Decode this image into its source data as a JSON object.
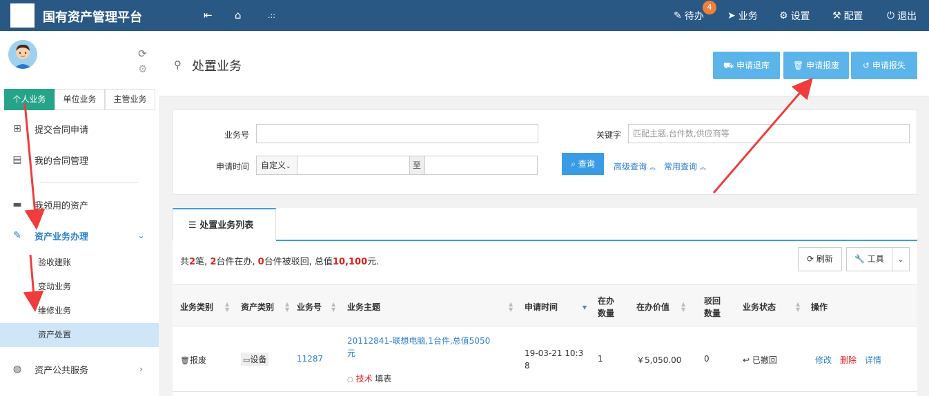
{
  "topbar": {
    "title": "国有资产管理平台",
    "todo_label": "待办",
    "todo_count": "4",
    "business_label": "业务",
    "settings_label": "设置",
    "config_label": "配置",
    "logout_label": "退出"
  },
  "sidebar": {
    "tabs": [
      "个人业务",
      "单位业务",
      "主管业务"
    ],
    "items": {
      "submit_contract": "提交合同申请",
      "my_contracts": "我的合同管理",
      "my_assets": "我领用的资产",
      "asset_business": "资产业务办理",
      "public_service": "资产公共服务"
    },
    "subitems": [
      "验收建账",
      "变动业务",
      "维修业务",
      "资产处置"
    ]
  },
  "header": {
    "page_title": "处置业务",
    "buttons": [
      "申请退库",
      "申请报废",
      "申请报失"
    ]
  },
  "search": {
    "business_no_label": "业务号",
    "keyword_label": "关键字",
    "keyword_placeholder": "匹配主题,台件数,供应商等",
    "apply_time_label": "申请时间",
    "date_mode": "自定义",
    "to_label": "至",
    "query_label": "查询",
    "advanced_label": "高级查询",
    "common_label": "常用查询"
  },
  "list": {
    "tab_label": "处置业务列表",
    "summary": {
      "prefix": "共",
      "count": "2",
      "t1": "笔, ",
      "inprogress": "2",
      "t2": "台件在办, ",
      "rejected": "0",
      "t3": "台件被驳回, 总值",
      "total": "10,100",
      "t4": "元."
    },
    "refresh_label": "刷新",
    "tools_label": "工具",
    "columns": [
      "业务类别",
      "资产类别",
      "业务号",
      "业务主题",
      "申请时间",
      "在办数量",
      "在办价值",
      "驳回数量",
      "业务状态",
      "操作"
    ],
    "columns_multi": {
      "inprogress_qty_1": "在办",
      "inprogress_qty_2": "数量",
      "rejected_qty_1": "驳回",
      "rejected_qty_2": "数量"
    },
    "rows": [
      {
        "category": "报废",
        "asset_type": "设备",
        "business_no": "11287",
        "subject_1": "20112841-联想电脑,1台件,总值5050",
        "subject_2": "元",
        "step_role": "技术",
        "step_action": "填表",
        "apply_time_1": "19-03-21 10:3",
        "apply_time_2": "8",
        "qty": "1",
        "value": "￥5,050.00",
        "rejected": "0",
        "status": "已撤回",
        "op_edit": "修改",
        "op_delete": "删除",
        "op_detail": "详情"
      }
    ]
  }
}
